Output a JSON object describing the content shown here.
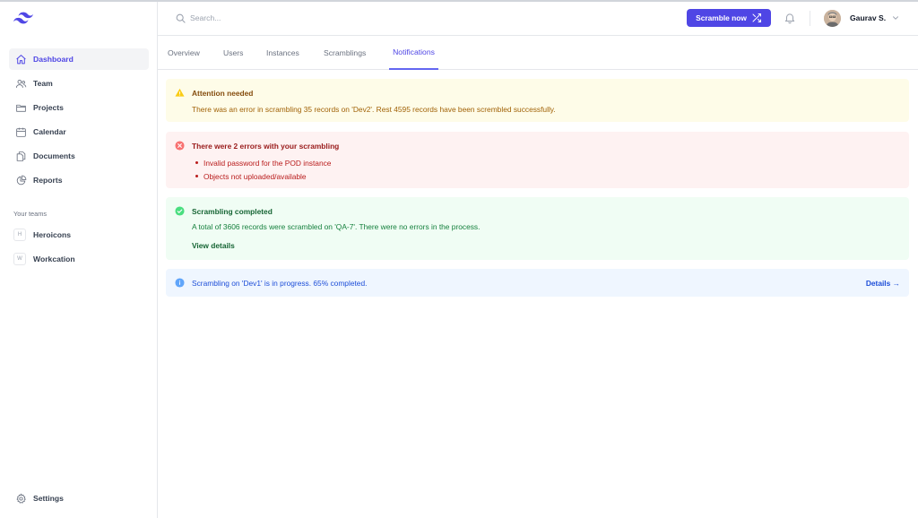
{
  "sidebar": {
    "logo": "tailwind-logo",
    "items": [
      {
        "label": "Dashboard",
        "icon": "home-icon",
        "active": true
      },
      {
        "label": "Team",
        "icon": "users-icon"
      },
      {
        "label": "Projects",
        "icon": "folder-icon"
      },
      {
        "label": "Calendar",
        "icon": "calendar-icon"
      },
      {
        "label": "Documents",
        "icon": "documents-icon"
      },
      {
        "label": "Reports",
        "icon": "chart-pie-icon"
      }
    ],
    "teams_heading": "Your teams",
    "teams": [
      {
        "initial": "H",
        "label": "Heroicons"
      },
      {
        "initial": "W",
        "label": "Workcation"
      }
    ],
    "settings_label": "Settings"
  },
  "header": {
    "search_placeholder": "Search...",
    "scramble_button": "Scramble now",
    "user_name": "Gaurav S."
  },
  "tabs": [
    {
      "label": "Overview"
    },
    {
      "label": "Users"
    },
    {
      "label": "Instances"
    },
    {
      "label": "Scramblings"
    },
    {
      "label": "Notifications",
      "active": true
    }
  ],
  "alerts": {
    "warning": {
      "title": "Attention needed",
      "text": "There was an error in scrambling 35 records on 'Dev2'. Rest 4595 records have been scrembled successfully."
    },
    "error": {
      "title": "There were 2 errors with your scrambling",
      "items": [
        "Invalid password for the POD instance",
        "Objects not uploaded/available"
      ]
    },
    "success": {
      "title": "Scrambling completed",
      "text": "A total of 3606 records were scrambled on 'QA-7'. There were no errors in the process.",
      "link": "View details"
    },
    "info": {
      "text": "Scrambling on 'Dev1' is in progress. 65% completed.",
      "link": "Details →"
    }
  },
  "colors": {
    "accent": "#4f46e5",
    "warning_bg": "#fefce8",
    "error_bg": "#fef2f2",
    "success_bg": "#f0fdf4",
    "info_bg": "#eff6ff"
  }
}
